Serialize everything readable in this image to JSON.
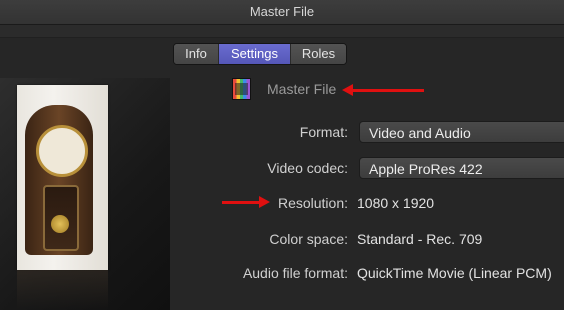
{
  "window": {
    "title": "Master File"
  },
  "tabs": [
    {
      "label": "Info",
      "active": false
    },
    {
      "label": "Settings",
      "active": true
    },
    {
      "label": "Roles",
      "active": false
    }
  ],
  "file": {
    "name": "Master File",
    "icon": "film-icon"
  },
  "settings": {
    "format": {
      "label": "Format:",
      "value": "Video and Audio"
    },
    "video_codec": {
      "label": "Video codec:",
      "value": "Apple ProRes 422"
    },
    "resolution": {
      "label": "Resolution:",
      "value": "1080 x 1920"
    },
    "color_space": {
      "label": "Color space:",
      "value": "Standard - Rec. 709"
    },
    "audio_file_format": {
      "label": "Audio file format:",
      "value": "QuickTime Movie (Linear PCM)"
    }
  },
  "colors": {
    "accent_tab": "#5d5fc4",
    "annotation_arrow": "#e01010"
  }
}
